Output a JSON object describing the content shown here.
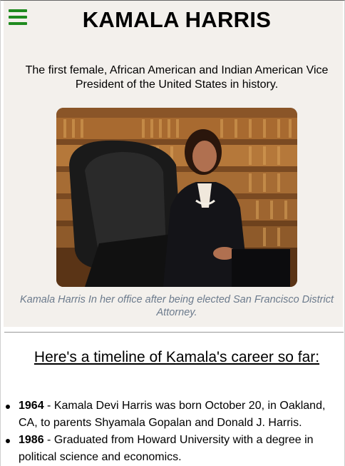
{
  "header": {
    "title": "KAMALA HARRIS",
    "menu_icon": "hamburger-menu-icon",
    "menu_color": "#1f8b1f"
  },
  "hero": {
    "subtitle": "The first female, African American and Indian American Vice President of the United States in history.",
    "photo_caption": "Kamala Harris In her office after being elected San Francisco District Attorney.",
    "background": "#f3f0ec"
  },
  "timeline": {
    "heading": "Here's a timeline of Kamala's career so far:",
    "items": [
      {
        "year": "1964",
        "text": " - Kamala Devi Harris was born October 20, in Oakland, CA, to parents Shyamala Gopalan and Donald J. Harris."
      },
      {
        "year": "1986",
        "text": " - Graduated from Howard University with a degree in political science and economics."
      }
    ]
  }
}
